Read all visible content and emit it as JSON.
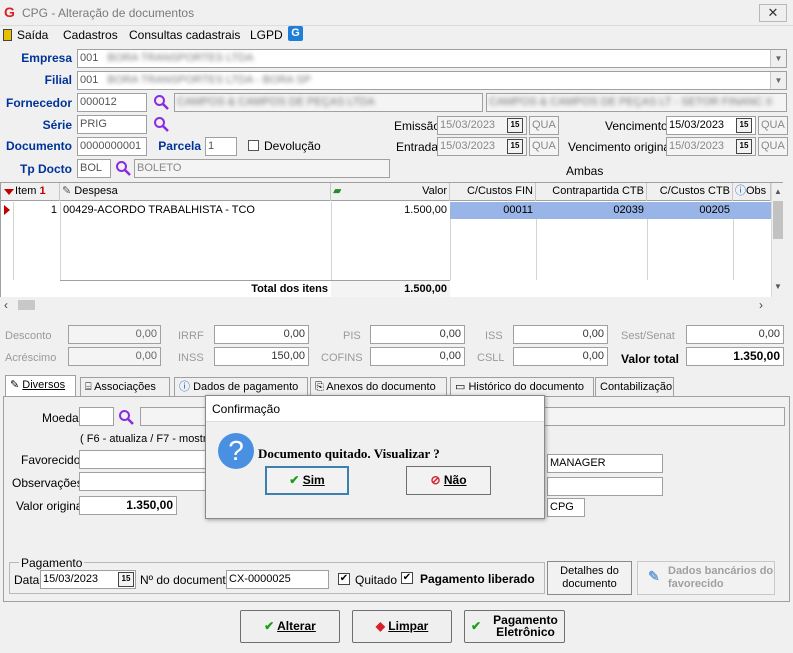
{
  "window": {
    "title": "CPG - Alteração de documentos",
    "close": "✕"
  },
  "menu": {
    "items": [
      "Saída",
      "Cadastros",
      "Consultas cadastrais",
      "LGPD"
    ]
  },
  "header": {
    "empresa": {
      "label": "Empresa",
      "code": "001",
      "name": "BORA TRANSPORTES LTDA"
    },
    "filial": {
      "label": "Filial",
      "code": "001",
      "name": "BORA TRANSPORTES LTDA - BORA SP"
    },
    "fornecedor": {
      "label": "Fornecedor",
      "code": "000012",
      "name1": "CAMPOS & CAMPOS DE PEÇAS LTDA",
      "name2": "CAMPOS & CAMPOS DE PEÇAS LT - SETOR FINANC II"
    },
    "serie": {
      "label": "Série",
      "value": "PRIG"
    },
    "documento": {
      "label": "Documento",
      "value": "0000000001"
    },
    "parcela": {
      "label": "Parcela",
      "value": "1"
    },
    "devolucao": {
      "label": "Devolução"
    },
    "tp_docto": {
      "label": "Tp Docto",
      "code": "BOL",
      "name": "BOLETO"
    },
    "emissao": {
      "label": "Emissão",
      "date": "15/03/2023",
      "day": "QUA"
    },
    "entrada": {
      "label": "Entrada",
      "date": "15/03/2023",
      "day": "QUA"
    },
    "vencimento": {
      "label": "Vencimento",
      "date": "15/03/2023",
      "day": "QUA"
    },
    "vencimento_original": {
      "label": "Vencimento original",
      "date": "15/03/2023",
      "day": "QUA"
    },
    "ambas": "Ambas",
    "cal": "15"
  },
  "grid": {
    "columns": [
      "Item",
      "Despesa",
      "Valor",
      "C/Custos FIN",
      "Contrapartida CTB",
      "C/Custos CTB",
      "Obs"
    ],
    "rows": [
      {
        "item": "1",
        "despesa": "00429-ACORDO TRABALHISTA - TCO",
        "valor": "1.500,00",
        "ccfin": "00011",
        "contrapartida": "02039",
        "ccctb": "00205"
      }
    ],
    "total_label": "Total dos itens",
    "total_value": "1.500,00"
  },
  "taxes": {
    "desconto": {
      "label": "Desconto",
      "value": "0,00"
    },
    "acrescimo": {
      "label": "Acréscimo",
      "value": "0,00"
    },
    "irrf": {
      "label": "IRRF",
      "value": "0,00"
    },
    "inss": {
      "label": "INSS",
      "value": "150,00"
    },
    "pis": {
      "label": "PIS",
      "value": "0,00"
    },
    "cofins": {
      "label": "COFINS",
      "value": "0,00"
    },
    "iss": {
      "label": "ISS",
      "value": "0,00"
    },
    "csll": {
      "label": "CSLL",
      "value": "0,00"
    },
    "sest": {
      "label": "Sest/Senat",
      "value": "0,00"
    },
    "valor_total": {
      "label": "Valor total",
      "value": "1.350,00"
    }
  },
  "tabs": [
    "Diversos",
    "Associações",
    "Dados de pagamento",
    "Anexos do documento",
    "Histórico do documento",
    "Contabilização"
  ],
  "diversos": {
    "moeda": "Moeda",
    "hint": "( F6 - atualiza / F7 - mostra",
    "favorecido": "Favorecido",
    "observacoes": "Observações",
    "valor_original_label": "Valor original",
    "valor_original": "1.350,00",
    "manager": "MANAGER",
    "cpg": "CPG"
  },
  "pagamento": {
    "group": "Pagamento",
    "data_label": "Data",
    "data": "15/03/2023",
    "ndoc_label": "Nº do documento",
    "ndoc": "CX-0000025",
    "quitado": "Quitado",
    "liberado": "Pagamento liberado",
    "detalhes": "Detalhes do documento",
    "bancarios": "Dados bancários do favorecido"
  },
  "buttons": {
    "alterar": "Alterar",
    "limpar": "Limpar",
    "pagamento": "Pagamento Eletrônico"
  },
  "dialog": {
    "title": "Confirmação",
    "message": "Documento quitado. Visualizar ?",
    "sim": "Sim",
    "nao": "Não"
  },
  "colors": {
    "label_blue": "#003399",
    "selection": "#99b4e6",
    "accent_red": "#d6202a"
  }
}
